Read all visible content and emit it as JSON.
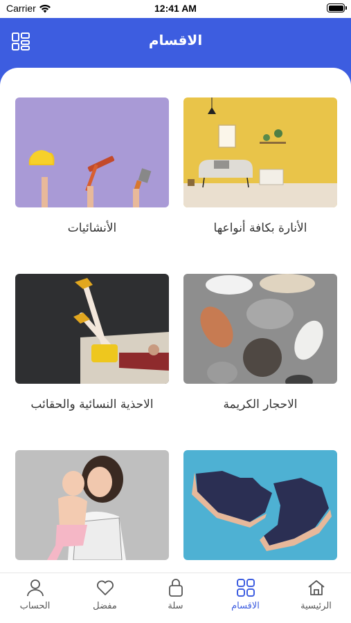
{
  "status": {
    "carrier": "Carrier",
    "time": "12:41 AM"
  },
  "header": {
    "title": "الاقسام"
  },
  "categories": [
    {
      "label": "الأنارة بكافة أنواعها"
    },
    {
      "label": "الأنشائيات"
    },
    {
      "label": "الاحجار الكريمة"
    },
    {
      "label": "الاحذية النسائية والحقائب"
    },
    {
      "label": ""
    },
    {
      "label": ""
    }
  ],
  "tabbar": {
    "items": [
      {
        "label": "الرئيسية",
        "icon": "home-icon"
      },
      {
        "label": "الاقسام",
        "icon": "grid-icon"
      },
      {
        "label": "سلة",
        "icon": "bag-icon"
      },
      {
        "label": "مفضل",
        "icon": "heart-icon"
      },
      {
        "label": "الحساب",
        "icon": "person-icon"
      }
    ],
    "active_color": "#3d5de0"
  },
  "colors": {
    "primary": "#3d5de0"
  }
}
